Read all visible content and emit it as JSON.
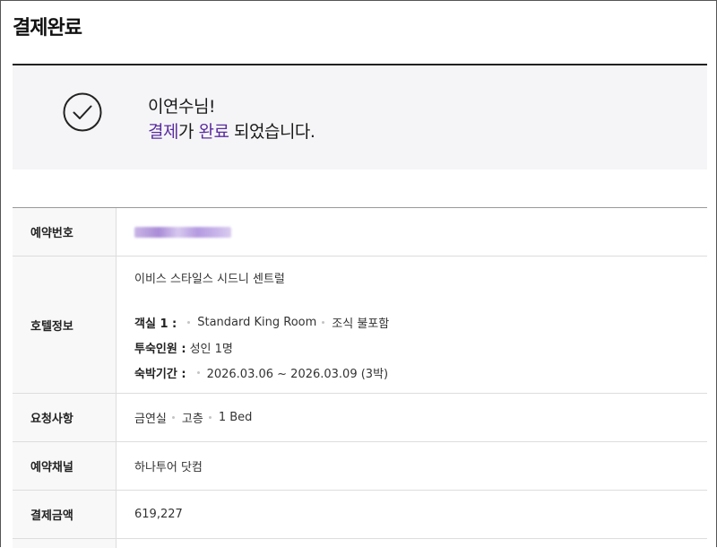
{
  "page": {
    "title": "결제완료"
  },
  "completion": {
    "name_line": "이연수님!",
    "word_payment": "결제",
    "particle": "가 ",
    "word_complete": "완료",
    "suffix": " 되었습니다.",
    "accent_color": "#5b2ca0",
    "icon": "check-circle-icon"
  },
  "table": {
    "booking_number": {
      "label": "예약번호",
      "value_state": "blurred"
    },
    "hotel": {
      "label": "호텔정보",
      "name": "이비스 스타일스 시드니 센트럴",
      "room_label": "객실 1 :",
      "room_type": "Standard King Room",
      "breakfast": "조식 불포함",
      "guests_label": "투숙인원 :",
      "guests": "성인 1명",
      "stay_label": "숙박기간 :",
      "stay": "2026.03.06 ~ 2026.03.09 (3박)"
    },
    "requests": {
      "label": "요청사항",
      "items": [
        "금연실",
        "고층",
        "1 Bed"
      ]
    },
    "channel": {
      "label": "예약채널",
      "value": "하나투어 닷컴"
    },
    "amount": {
      "label": "결제금액",
      "value": "619,227"
    }
  }
}
